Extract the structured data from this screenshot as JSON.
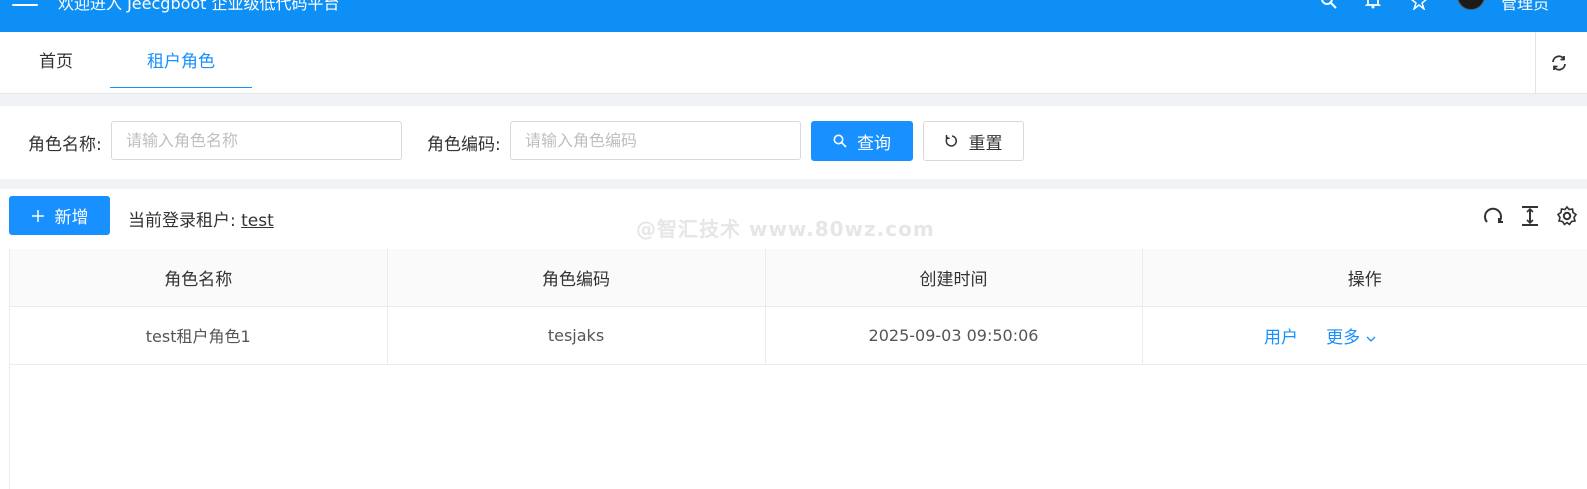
{
  "header": {
    "title": "欢迎进入 Jeecgboot 企业级低代码平台",
    "user_name": "管理员",
    "bg_color": "#0d8ff5"
  },
  "tabs": [
    {
      "label": "首页",
      "active": false
    },
    {
      "label": "租户角色",
      "active": true
    }
  ],
  "search": {
    "role_name_label": "角色名称:",
    "role_name_placeholder": "请输入角色名称",
    "role_code_label": "角色编码:",
    "role_code_placeholder": "请输入角色编码",
    "query_label": "查询",
    "reset_label": "重置"
  },
  "toolbar": {
    "add_label": "新增",
    "tenant_label": "当前登录租户:",
    "tenant_value": "test"
  },
  "watermark": "@智汇技术 www.80wz.com",
  "table": {
    "columns": [
      "角色名称",
      "角色编码",
      "创建时间",
      "操作"
    ],
    "rows": [
      {
        "name": "test租户角色1",
        "code": "tesjaks",
        "created": "2025-09-03 09:50:06",
        "action_user": "用户",
        "action_more": "更多"
      }
    ]
  },
  "colors": {
    "accent": "#1890ff"
  }
}
